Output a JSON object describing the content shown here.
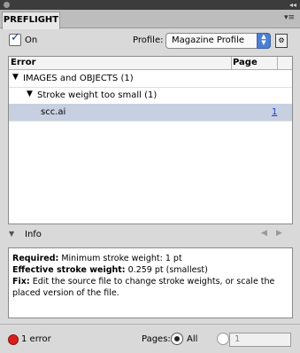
{
  "panel": {
    "tab_title": "PREFLIGHT",
    "menu_glyph": "▾≡"
  },
  "toolbar": {
    "on_label": "On",
    "on_checked": true,
    "profile_label": "Profile:",
    "profile_value": "Magazine Profile"
  },
  "list": {
    "col_error": "Error",
    "col_page": "Page",
    "rows": [
      {
        "text": "IMAGES and OBJECTS (1)",
        "page": ""
      },
      {
        "text": "Stroke weight too small (1)",
        "page": ""
      },
      {
        "text": "scc.ai",
        "page": "1"
      }
    ]
  },
  "info": {
    "label": "Info",
    "required_label": "Required:",
    "required_value": "Minimum stroke weight: 1 pt",
    "effective_label": "Effective stroke weight:",
    "effective_value": "0.259 pt (smallest)",
    "fix_label": "Fix:",
    "fix_line1": "Edit the source file to change stroke weights, or scale the",
    "fix_line2": "placed version of the file."
  },
  "status": {
    "error_count": "1 error",
    "error_color": "#d82020",
    "pages_label": "Pages:",
    "all_label": "All",
    "range_value": "1"
  }
}
